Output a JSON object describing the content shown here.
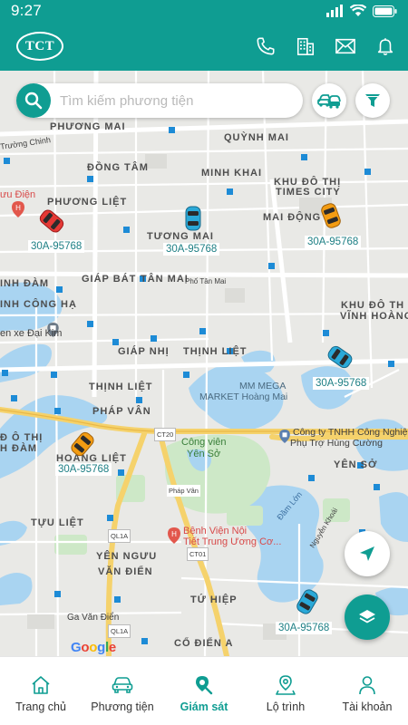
{
  "status_bar": {
    "time": "9:27"
  },
  "header": {
    "logo_text": "TCT"
  },
  "search": {
    "placeholder": "Tìm kiếm phương tiện"
  },
  "map": {
    "labels": {
      "phuong_mai": "PHƯƠNG MAI",
      "quynh_mai": "QUỲNH MAI",
      "dong_tam": "ĐỒNG TÂM",
      "minh_khai": "MINH KHAI",
      "kdt_times_city_1": "KHU ĐÔ THỊ",
      "kdt_times_city_2": "TIMES CITY",
      "phuong_liet": "PHƯƠNG LIỆT",
      "tuong_mai": "TƯƠNG MAI",
      "mai_dong": "MAI ĐỘNG",
      "giap_bat": "GIÁP BÁT",
      "tan_mai": "TÂN MAI",
      "linh_dam": "INH ĐÀM",
      "cong_ha": "INH CÔNG HẠ",
      "kdt_vinh_hoang_1": "KHU ĐÔ TH",
      "kdt_vinh_hoang_2": "VĨNH HOÀNG",
      "giap_nhi": "GIÁP NHỊ",
      "thinh_liet_north": "THỊNH LIỆT",
      "thinh_liet": "THỊNH LIỆT",
      "phap_van": "PHÁP VÂN",
      "do_thi_1": "Đ Ô THỊ",
      "do_thi_2": "H ĐÀM",
      "hoang_liet": "HOÀNG LIỆT",
      "yen_so": "YÊN SỞ",
      "tuu_liet": "TỰU LIỆT",
      "yen_nguu": "YÊN NGƯU",
      "van_dien": "VĂN ĐIỂN",
      "tu_hiep": "TỨ HIỆP",
      "co_dien_a": "CỔ ĐIỂN A"
    },
    "poi": {
      "buu_dien": "ưu Điện",
      "truong_chinh": "Trường Chinh",
      "ben_xe_dai_kim": "en xe Đại Kim",
      "phd_tan_mai": "Phố Tân Mai",
      "mm_mega_1": "MM MEGA",
      "mm_mega_2": "MARKET Hoàng Mai",
      "cong_ty_1": "Công ty TNHH Công Nghiệp",
      "cong_ty_2": "Phụ Trợ Hùng Cường",
      "cong_vien_1": "Công viên",
      "cong_vien_2": "Yên Sở",
      "benh_vien_1": "Bệnh Viện Nội",
      "benh_vien_2": "Tiết Trung Ương Cơ...",
      "ga_van_dien": "Ga Văn Điển",
      "dam_lon": "Đầm Lớn",
      "nguyen_khoai": "Nguyễn Khoái",
      "phap_van_road": "Pháp Vân",
      "ct20": "CT20",
      "ql1a_1": "QL1A",
      "ql1a_2": "QL1A",
      "ct01": "CT01"
    },
    "google_letters": [
      "G",
      "o",
      "o",
      "g",
      "l",
      "e"
    ]
  },
  "vehicles": [
    {
      "plate": "30A-95768",
      "color": "red"
    },
    {
      "plate": "30A-95768",
      "color": "cyan"
    },
    {
      "plate": "30A-95768",
      "color": "orange"
    },
    {
      "plate": "30A-95768",
      "color": "cyan"
    },
    {
      "plate": "30A-95768",
      "color": "orange"
    },
    {
      "plate": "30A-95768",
      "color": "cyan"
    }
  ],
  "bottom_nav": {
    "items": [
      {
        "label": "Trang chủ",
        "icon": "home-icon",
        "active": false
      },
      {
        "label": "Phương tiện",
        "icon": "car-icon",
        "active": false
      },
      {
        "label": "Giám sát",
        "icon": "map-search-icon",
        "active": true
      },
      {
        "label": "Lộ trình",
        "icon": "route-pin-icon",
        "active": false
      },
      {
        "label": "Tài khoản",
        "icon": "user-icon",
        "active": false
      }
    ]
  },
  "colors": {
    "primary": "#0f9d92",
    "water": "#a9d4f1",
    "park": "#cde8c7",
    "road_major": "#f7d77a"
  }
}
